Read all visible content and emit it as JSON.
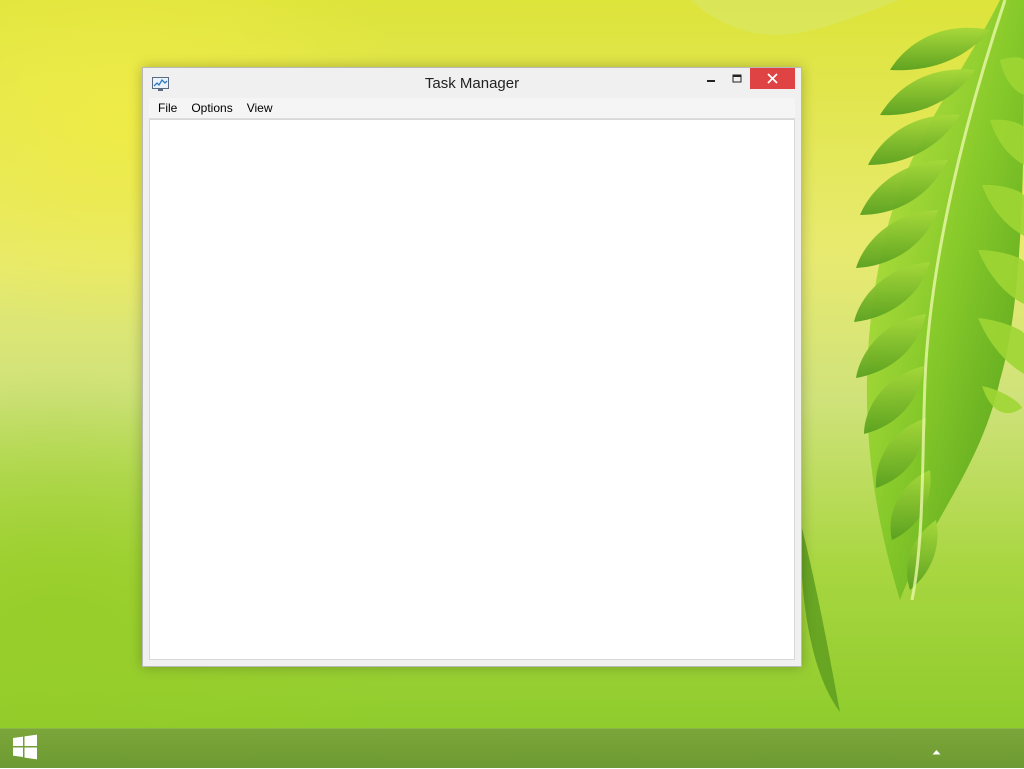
{
  "window": {
    "title": "Task Manager",
    "icon": "task-manager-icon",
    "controls": {
      "minimize": "minimize-icon",
      "maximize": "maximize-icon",
      "close": "close-icon",
      "close_color": "#e04343"
    }
  },
  "menubar": {
    "items": [
      {
        "label": "File"
      },
      {
        "label": "Options"
      },
      {
        "label": "View"
      }
    ]
  },
  "taskbar": {
    "start_icon": "windows-logo-icon",
    "tray_icon": "show-hidden-icons-chevron"
  },
  "colors": {
    "taskbar": "#6e9a33",
    "wallpaper_primary": "#dde43a",
    "wallpaper_leaf": "#7cc226"
  }
}
